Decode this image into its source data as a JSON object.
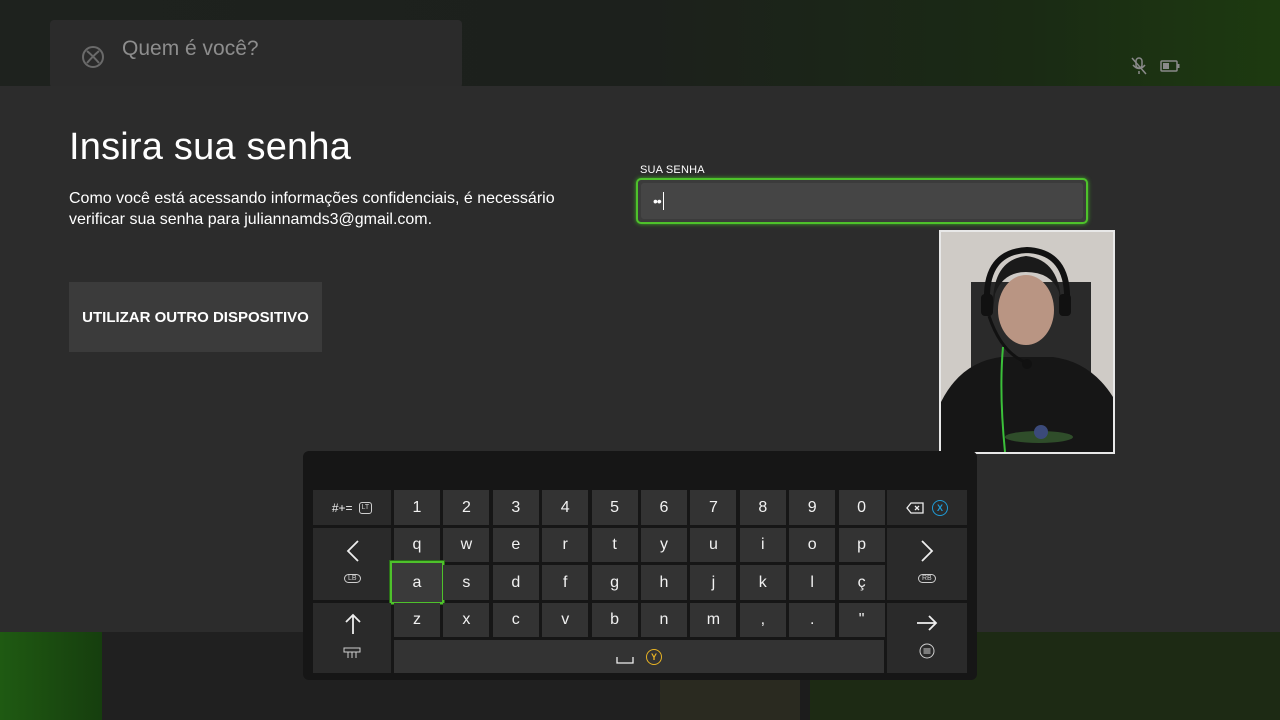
{
  "header": {
    "title": "Quem é você?"
  },
  "main": {
    "heading": "Insira sua senha",
    "description": "Como você está acessando informações confidenciais, é necessário verificar sua senha para juliannamds3@gmail.com.",
    "other_device_button": "UTILIZAR OUTRO DISPOSITIVO",
    "password_label": "SUA SENHA",
    "password_value": "••"
  },
  "keyboard": {
    "symbols_key": "#+=",
    "symbols_badge": "LT",
    "number_row": [
      "1",
      "2",
      "3",
      "4",
      "5",
      "6",
      "7",
      "8",
      "9",
      "0"
    ],
    "row1": [
      "q",
      "w",
      "e",
      "r",
      "t",
      "y",
      "u",
      "i",
      "o",
      "p"
    ],
    "row2": [
      "a",
      "s",
      "d",
      "f",
      "g",
      "h",
      "j",
      "k",
      "l",
      "ç"
    ],
    "row3": [
      "z",
      "x",
      "c",
      "v",
      "b",
      "n",
      "m",
      ",",
      ".",
      "\""
    ],
    "selected_key": "a",
    "backspace_badge": "X",
    "left_key_badge": "LB",
    "right_key_badge": "RB",
    "space_badge": "Y",
    "colors": {
      "accent_green": "#4ec22b",
      "x_button": "#1f9bd6",
      "y_button": "#e8b324"
    }
  },
  "icons": [
    "xbox-logo-icon",
    "mic-muted-icon",
    "battery-icon",
    "chevron-left-icon",
    "chevron-right-icon",
    "shift-up-icon",
    "enter-arrow-icon",
    "backspace-icon",
    "menu-icon",
    "space-icon"
  ]
}
